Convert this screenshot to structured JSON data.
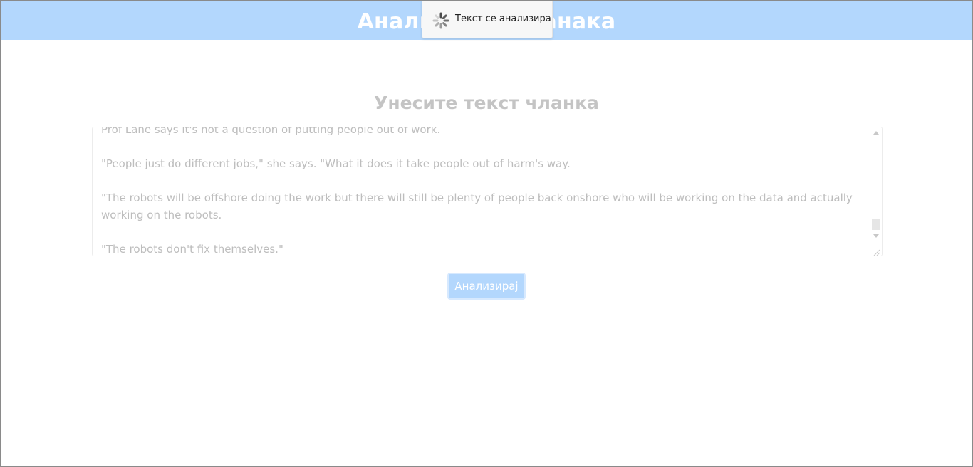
{
  "header": {
    "title": "Анализатор чланака"
  },
  "toast": {
    "icon": "spinner-icon",
    "message": "Текст се анализира"
  },
  "form": {
    "heading": "Унесите текст чланка",
    "article_paragraphs": [
      "Prof Lane says it's not a question of putting people out of work.",
      "\"People just do different jobs,\" she says. \"What it does it take people out of harm's way.",
      "\"The robots will be offshore doing the work but there will still be plenty of people back onshore who will be working on the data and actually working on the robots.",
      "\"The robots don't fix themselves.\""
    ],
    "submit_label": "Анализирај"
  },
  "colors": {
    "header_bg": "#b3d7fd",
    "button_bg": "#b3d7fd",
    "heading_text": "#c4c4c4",
    "textarea_text": "#bdbdbd"
  }
}
